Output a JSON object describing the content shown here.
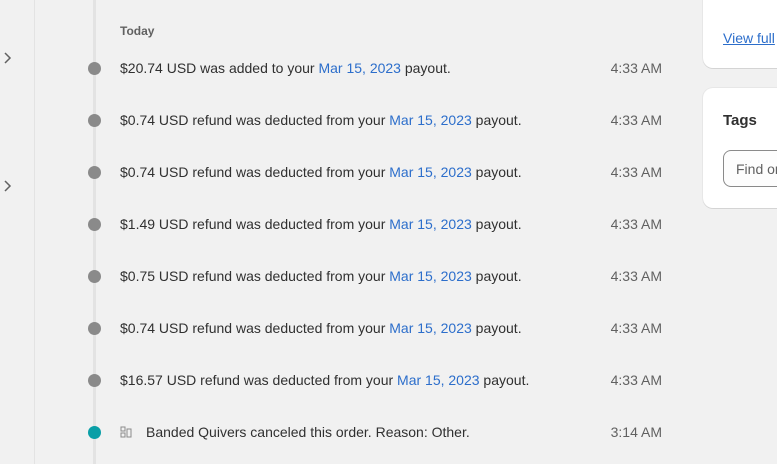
{
  "timeline": {
    "day_heading": "Today",
    "events": [
      {
        "prefix": "$20.74 USD was added to your ",
        "link": "Mar 15, 2023",
        "suffix": " payout.",
        "time": "4:33 AM"
      },
      {
        "prefix": "$0.74 USD refund was deducted from your ",
        "link": "Mar 15, 2023",
        "suffix": " payout.",
        "time": "4:33 AM"
      },
      {
        "prefix": "$0.74 USD refund was deducted from your ",
        "link": "Mar 15, 2023",
        "suffix": " payout.",
        "time": "4:33 AM"
      },
      {
        "prefix": "$1.49 USD refund was deducted from your ",
        "link": "Mar 15, 2023",
        "suffix": " payout.",
        "time": "4:33 AM"
      },
      {
        "prefix": "$0.75 USD refund was deducted from your ",
        "link": "Mar 15, 2023",
        "suffix": " payout.",
        "time": "4:33 AM"
      },
      {
        "prefix": "$0.74 USD refund was deducted from your ",
        "link": "Mar 15, 2023",
        "suffix": " payout.",
        "time": "4:33 AM"
      },
      {
        "prefix": "$16.57 USD refund was deducted from your ",
        "link": "Mar 15, 2023",
        "suffix": " payout.",
        "time": "4:33 AM"
      },
      {
        "text": "Banded Quivers canceled this order. Reason: Other.",
        "time": "3:14 AM",
        "icon": "app-icon"
      }
    ]
  },
  "side": {
    "view_full_label": "View full",
    "tags_title": "Tags",
    "tags_placeholder": "Find or"
  },
  "colors": {
    "link": "#2c6ecb",
    "dot_default": "#8a8a8a",
    "dot_highlight": "#0a9fa7"
  },
  "icons": [
    "chevron-right-icon",
    "app-icon"
  ]
}
